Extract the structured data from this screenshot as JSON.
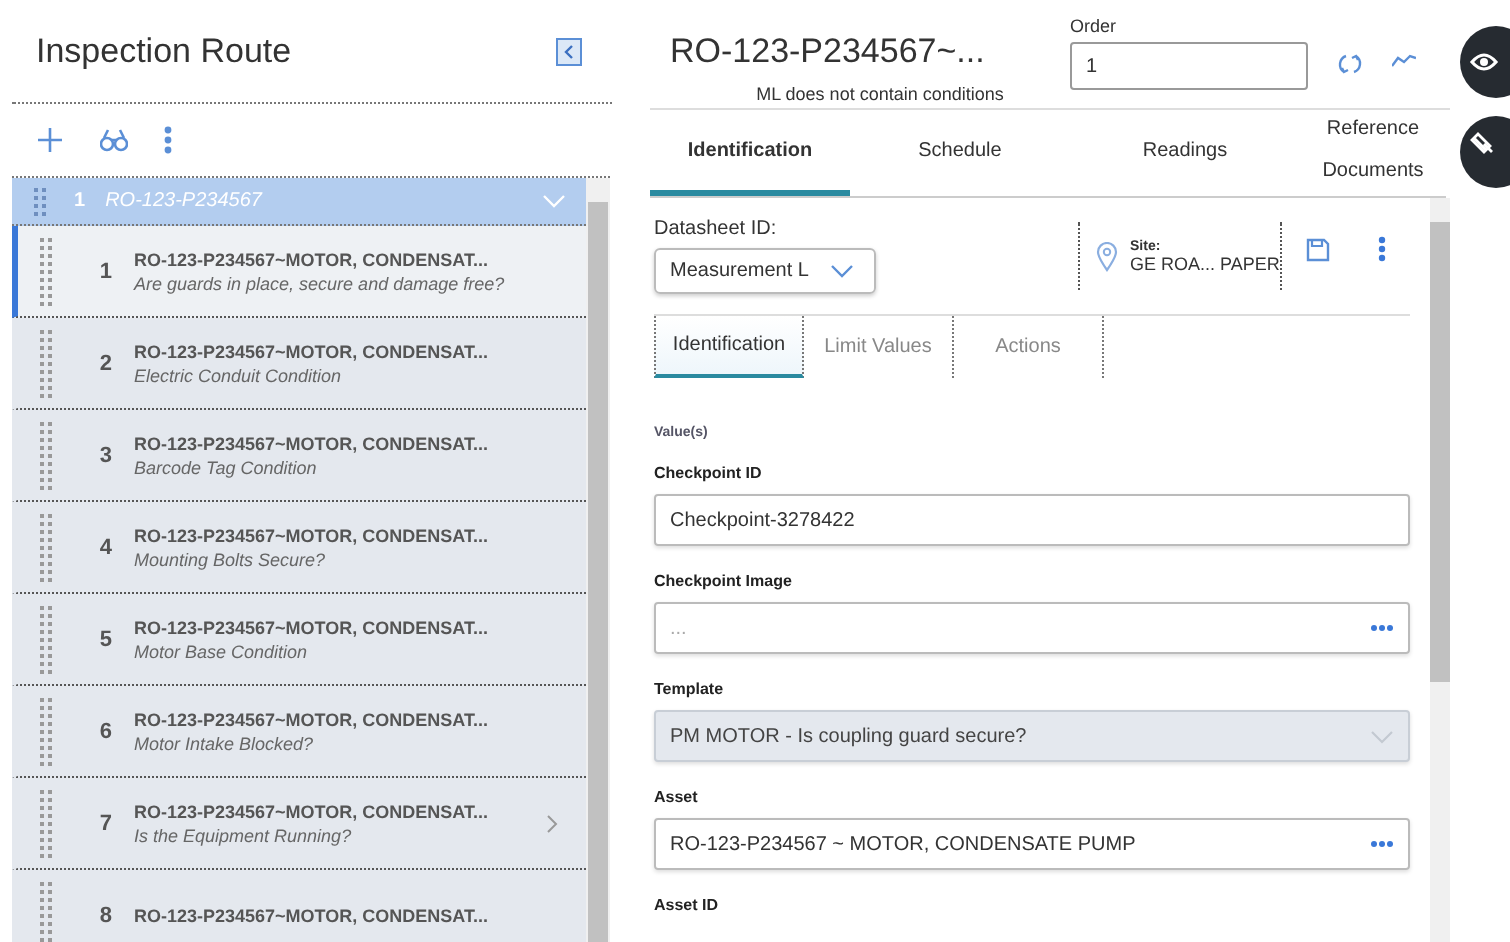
{
  "route_panel": {
    "title": "Inspection Route",
    "route": {
      "number": "1",
      "name": "RO-123-P234567",
      "expanded": true,
      "items": [
        {
          "number": "1",
          "title": "RO-123-P234567~MOTOR, CONDENSAT...",
          "subtitle": "Are guards in place, secure and damage free?",
          "selected": true,
          "hovered": false
        },
        {
          "number": "2",
          "title": "RO-123-P234567~MOTOR, CONDENSAT...",
          "subtitle": "Electric Conduit Condition",
          "selected": false,
          "hovered": false
        },
        {
          "number": "3",
          "title": "RO-123-P234567~MOTOR, CONDENSAT...",
          "subtitle": "Barcode Tag Condition",
          "selected": false,
          "hovered": false
        },
        {
          "number": "4",
          "title": "RO-123-P234567~MOTOR, CONDENSAT...",
          "subtitle": "Mounting Bolts Secure?",
          "selected": false,
          "hovered": false
        },
        {
          "number": "5",
          "title": "RO-123-P234567~MOTOR, CONDENSAT...",
          "subtitle": "Motor Base Condition",
          "selected": false,
          "hovered": false
        },
        {
          "number": "6",
          "title": "RO-123-P234567~MOTOR, CONDENSAT...",
          "subtitle": "Motor Intake Blocked?",
          "selected": false,
          "hovered": false
        },
        {
          "number": "7",
          "title": "RO-123-P234567~MOTOR, CONDENSAT...",
          "subtitle": "Is the Equipment Running?",
          "selected": false,
          "hovered": true
        },
        {
          "number": "8",
          "title": "RO-123-P234567~MOTOR, CONDENSAT...",
          "selected": false,
          "hovered": false
        }
      ]
    }
  },
  "record": {
    "title": "RO-123-P234567~...",
    "subtitle": "ML does not contain conditions",
    "order": {
      "label": "Order",
      "value": "1"
    }
  },
  "tabs": [
    {
      "label": "Identification",
      "selected": true
    },
    {
      "label": "Schedule",
      "selected": false
    },
    {
      "label": "Readings",
      "selected": false
    },
    {
      "label": "Reference Documents",
      "selected": false
    }
  ],
  "datasheet": {
    "label": "Datasheet ID:",
    "value": "Measurement L"
  },
  "site": {
    "label": "Site:",
    "value": "GE ROA... PAPER"
  },
  "subtabs": [
    {
      "label": "Identification",
      "selected": true
    },
    {
      "label": "Limit Values",
      "selected": false
    },
    {
      "label": "Actions",
      "selected": false
    }
  ],
  "section": "Value(s)",
  "fields": [
    {
      "label": "Checkpoint ID",
      "kind": "text",
      "value": "Checkpoint-3278422"
    },
    {
      "label": "Checkpoint Image",
      "kind": "picker",
      "placeholder": "..."
    },
    {
      "label": "Template",
      "kind": "select",
      "value": "PM MOTOR - Is coupling guard secure?",
      "disabled": true
    },
    {
      "label": "Asset",
      "kind": "picker",
      "value": "RO-123-P234567 ~ MOTOR, CONDENSATE PUMP"
    },
    {
      "label": "Asset ID",
      "kind": "heading"
    }
  ]
}
